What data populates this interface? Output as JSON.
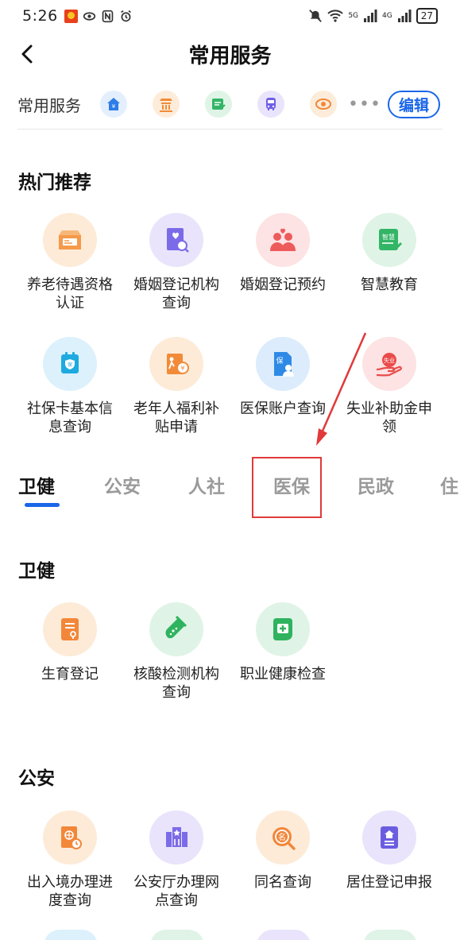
{
  "status_bar": {
    "time": "5:26",
    "signal_labels": [
      "5G",
      "4G"
    ],
    "battery": "27"
  },
  "header": {
    "title": "常用服务"
  },
  "favorites": {
    "label": "常用服务",
    "more": "•••",
    "edit_label": "编辑"
  },
  "hot": {
    "title": "热门推荐",
    "items": [
      {
        "label": "养老待遇资格认证",
        "icon": "pension-card-icon",
        "bg": "#fdebd8",
        "fg": "#f59a4a"
      },
      {
        "label": "婚姻登记机构查询",
        "icon": "marriage-search-icon",
        "bg": "#e9e4fb",
        "fg": "#7b6be8"
      },
      {
        "label": "婚姻登记预约",
        "icon": "couple-heart-icon",
        "bg": "#fde3e3",
        "fg": "#ee5b5b"
      },
      {
        "label": "智慧教育",
        "icon": "smart-edu-icon",
        "bg": "#dff4e6",
        "fg": "#33b566"
      },
      {
        "label": "社保卡基本信息查询",
        "icon": "social-card-icon",
        "bg": "#dcf1fb",
        "fg": "#1eaadf"
      },
      {
        "label": "老年人福利补贴申请",
        "icon": "elder-subsidy-icon",
        "bg": "#fdebd8",
        "fg": "#f28b38"
      },
      {
        "label": "医保账户查询",
        "icon": "medical-account-icon",
        "bg": "#dcecfc",
        "fg": "#2f8ae6"
      },
      {
        "label": "失业补助金申领",
        "icon": "unemployment-icon",
        "bg": "#fde3e3",
        "fg": "#ea4b4b"
      }
    ]
  },
  "tabs": {
    "items": [
      "卫健",
      "公安",
      "人社",
      "医保",
      "民政",
      "住"
    ],
    "active": 0
  },
  "weijian": {
    "title": "卫健",
    "items": [
      {
        "label": "生育登记",
        "icon": "birth-register-icon",
        "bg": "#fdebd8",
        "fg": "#f2873a"
      },
      {
        "label": "核酸检测机构查询",
        "icon": "test-tube-icon",
        "bg": "#dff4e6",
        "fg": "#2fb35e"
      },
      {
        "label": "职业健康检查",
        "icon": "health-check-icon",
        "bg": "#dff4e6",
        "fg": "#2fb35e"
      }
    ]
  },
  "gongan": {
    "title": "公安",
    "items": [
      {
        "label": "出入境办理进度查询",
        "icon": "passport-icon",
        "bg": "#fdebd8",
        "fg": "#f2873a"
      },
      {
        "label": "公安厅办理网点查询",
        "icon": "office-building-icon",
        "bg": "#e9e4fb",
        "fg": "#7b6be8"
      },
      {
        "label": "同名查询",
        "icon": "name-search-icon",
        "bg": "#fdebd8",
        "fg": "#f2873a"
      },
      {
        "label": "居住登记申报",
        "icon": "residence-icon",
        "bg": "#e9e4fb",
        "fg": "#6b5de0"
      }
    ]
  },
  "colors": {
    "accent": "#1a66e8",
    "annotation_red": "#e03a3a"
  }
}
